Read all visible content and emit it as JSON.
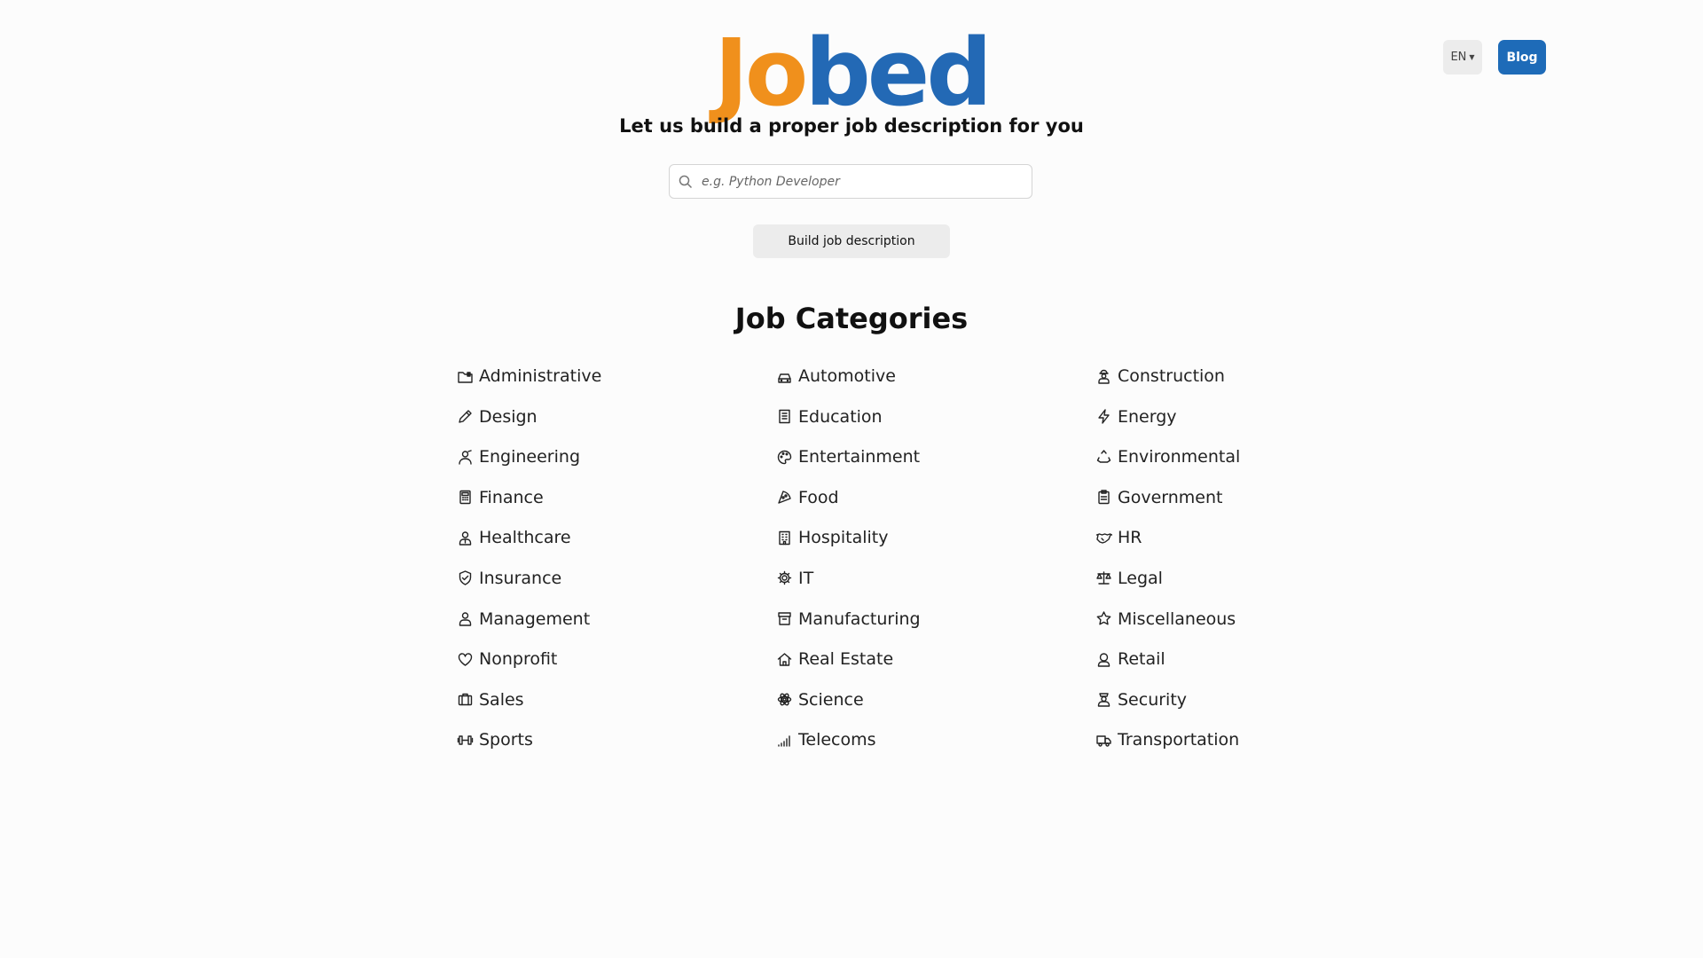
{
  "brand": {
    "logo_part1": "Jo",
    "logo_part2": "bed",
    "accent_orange": "#f0901c",
    "accent_blue": "#2369b5"
  },
  "header": {
    "language": "EN",
    "blog_label": "Blog"
  },
  "hero": {
    "tagline": "Let us build a proper job description for you",
    "search_placeholder": "e.g. Python Developer",
    "search_value": "",
    "build_button": "Build job description"
  },
  "categories": {
    "title": "Job Categories",
    "items": [
      {
        "label": "Administrative",
        "icon": "folder-icon"
      },
      {
        "label": "Automotive",
        "icon": "car-icon"
      },
      {
        "label": "Construction",
        "icon": "worker-icon"
      },
      {
        "label": "Design",
        "icon": "pencil-icon"
      },
      {
        "label": "Education",
        "icon": "book-icon"
      },
      {
        "label": "Energy",
        "icon": "bolt-icon"
      },
      {
        "label": "Engineering",
        "icon": "engineer-icon"
      },
      {
        "label": "Entertainment",
        "icon": "palette-icon"
      },
      {
        "label": "Environmental",
        "icon": "recycle-icon"
      },
      {
        "label": "Finance",
        "icon": "calculator-icon"
      },
      {
        "label": "Food",
        "icon": "pizza-icon"
      },
      {
        "label": "Government",
        "icon": "clipboard-icon"
      },
      {
        "label": "Healthcare",
        "icon": "doctor-icon"
      },
      {
        "label": "Hospitality",
        "icon": "hotel-icon"
      },
      {
        "label": "HR",
        "icon": "handshake-icon"
      },
      {
        "label": "Insurance",
        "icon": "shield-icon"
      },
      {
        "label": "IT",
        "icon": "gear-icon"
      },
      {
        "label": "Legal",
        "icon": "scale-icon"
      },
      {
        "label": "Management",
        "icon": "manager-icon"
      },
      {
        "label": "Manufacturing",
        "icon": "archive-icon"
      },
      {
        "label": "Miscellaneous",
        "icon": "star-icon"
      },
      {
        "label": "Nonprofit",
        "icon": "heart-icon"
      },
      {
        "label": "Real Estate",
        "icon": "house-icon"
      },
      {
        "label": "Retail",
        "icon": "shopper-icon"
      },
      {
        "label": "Sales",
        "icon": "briefcase-icon"
      },
      {
        "label": "Science",
        "icon": "atom-icon"
      },
      {
        "label": "Security",
        "icon": "guard-icon"
      },
      {
        "label": "Sports",
        "icon": "dumbbell-icon"
      },
      {
        "label": "Telecoms",
        "icon": "signal-icon"
      },
      {
        "label": "Transportation",
        "icon": "truck-icon"
      }
    ]
  }
}
